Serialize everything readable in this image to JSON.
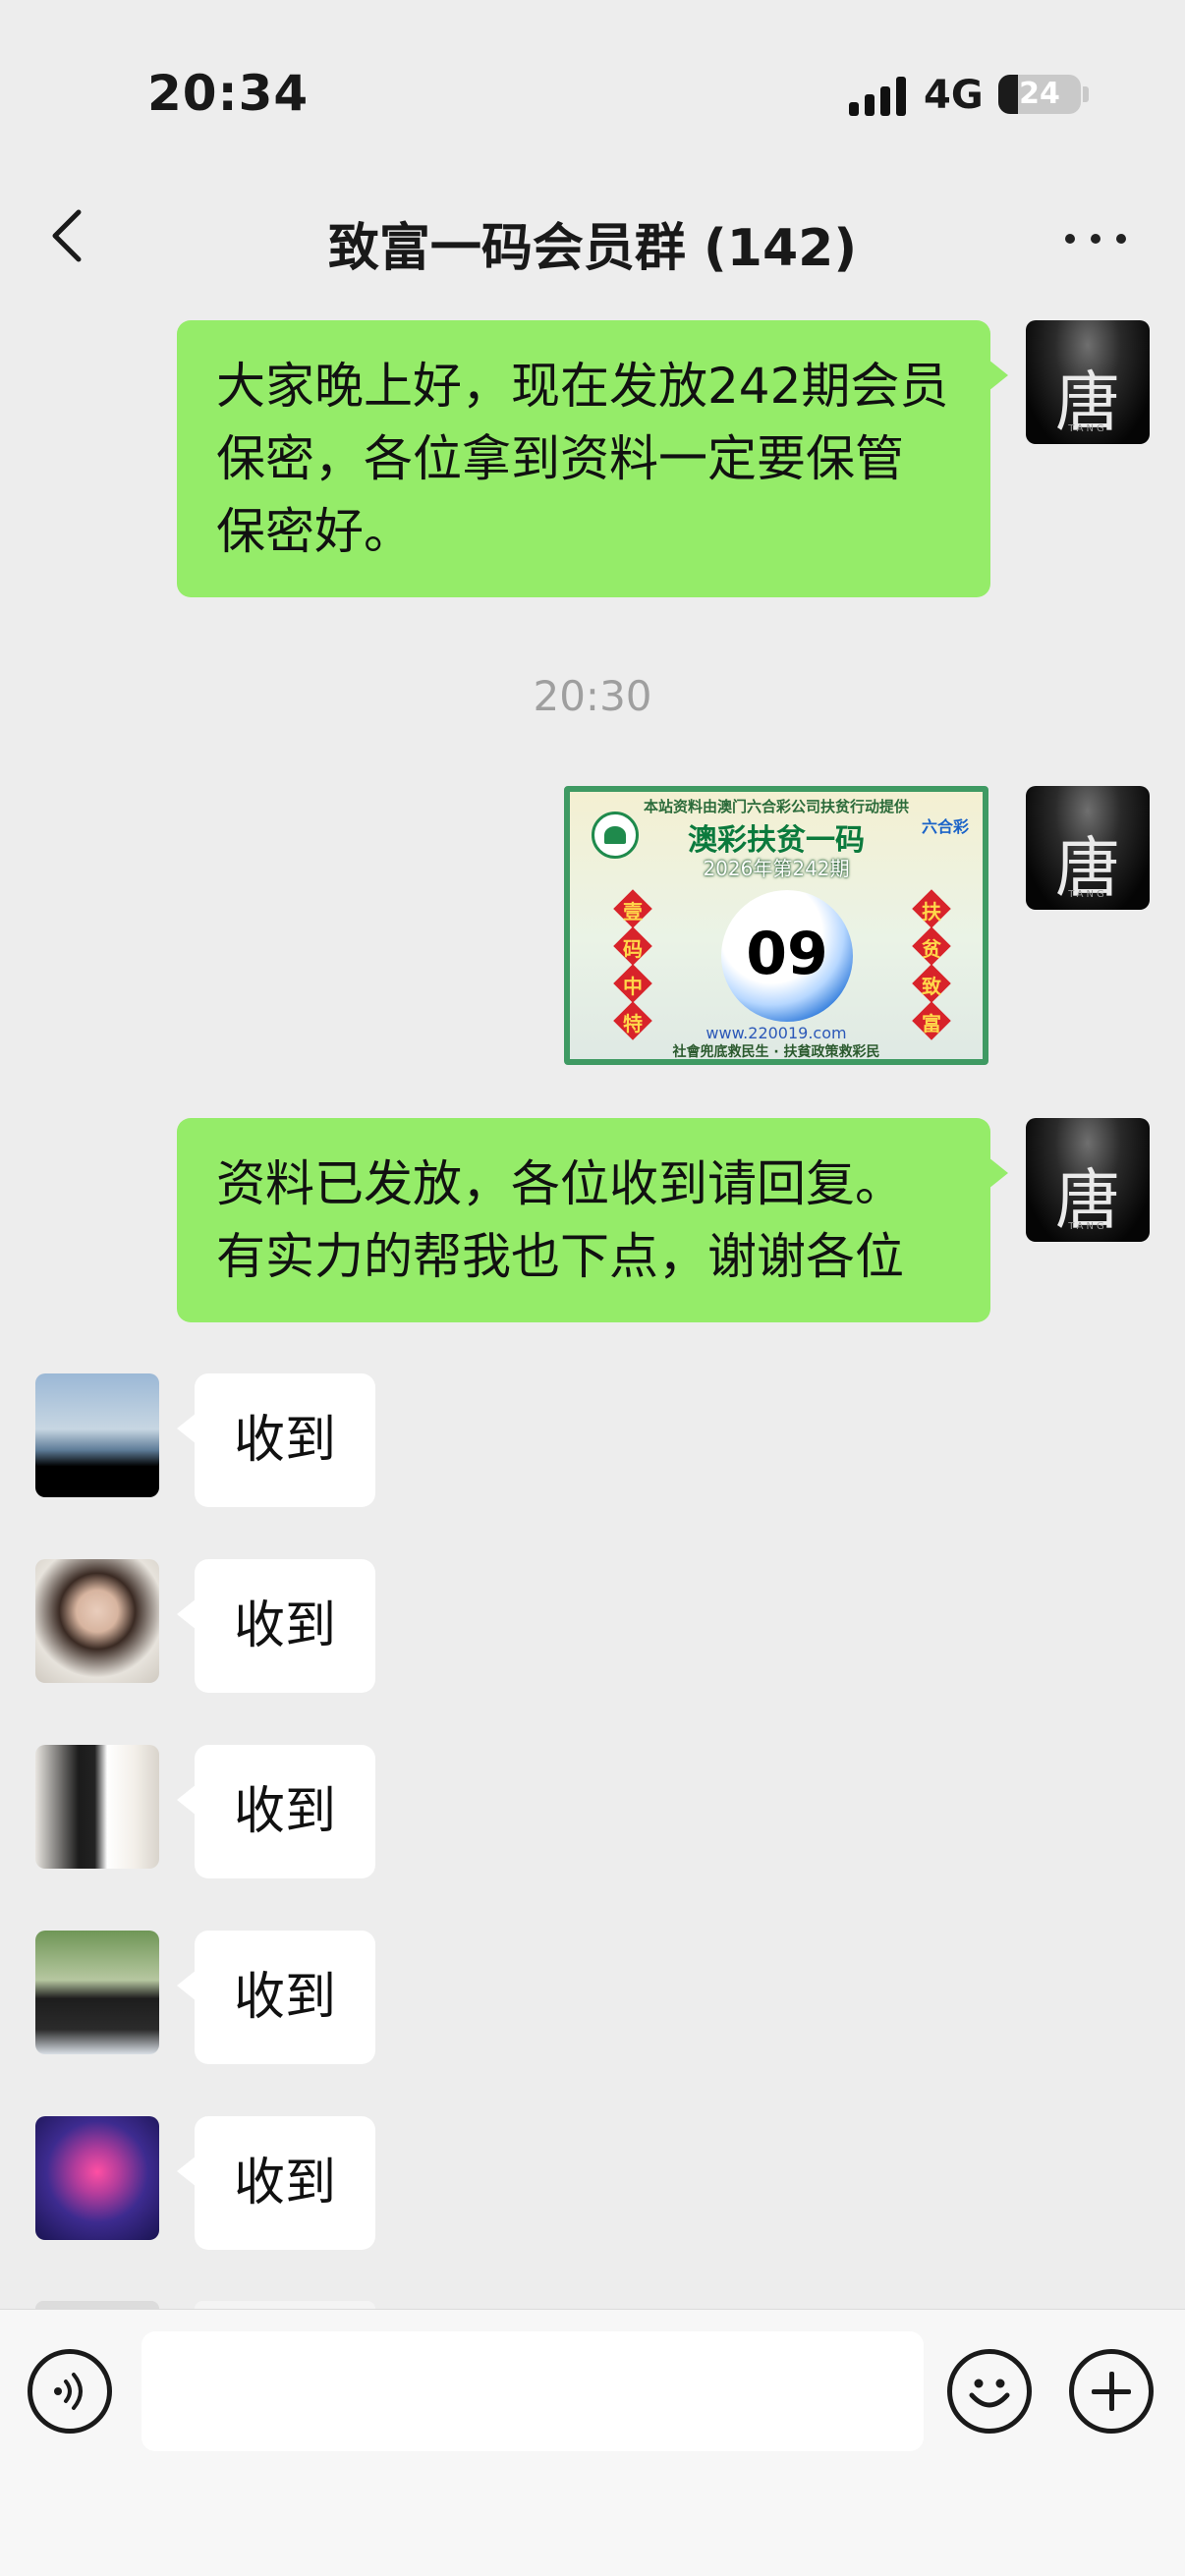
{
  "status_bar": {
    "time": "20:34",
    "network": "4G",
    "battery_level": "24"
  },
  "header": {
    "title": "致富一码会员群 (142)"
  },
  "avatar_text": {
    "glyph": "唐",
    "sub": "TANG"
  },
  "messages": [
    {
      "sender": "self",
      "text": "大家晚上好，现在发放242期会员保密，各位拿到资料一定要保管保密好。"
    },
    {
      "type": "timestamp",
      "text": "20:30"
    },
    {
      "sender": "self",
      "type": "image",
      "image": {
        "top_line": "本站资料由澳门六合彩公司扶贫行动提供",
        "title": "澳彩扶贫一码",
        "issue": "2026年第242期",
        "logo": "六合彩",
        "number": "09",
        "left_chars": [
          "壹",
          "码",
          "中",
          "特"
        ],
        "right_chars": [
          "扶",
          "贫",
          "致",
          "富"
        ],
        "url": "www.220019.com",
        "slogan": "社會兜底救民生 · 扶貧政策救彩民"
      }
    },
    {
      "sender": "self",
      "text": "资料已发放，各位收到请回复。有实力的帮我也下点，谢谢各位"
    },
    {
      "sender": "member1",
      "text": "收到"
    },
    {
      "sender": "member2",
      "text": "收到"
    },
    {
      "sender": "member3",
      "text": "收到"
    },
    {
      "sender": "member4",
      "text": "收到"
    },
    {
      "sender": "member5",
      "text": "收到"
    }
  ],
  "input_bar": {
    "value": "",
    "icons": [
      "voice-icon",
      "emoji-icon",
      "plus-icon"
    ]
  },
  "colors": {
    "background": "#ededed",
    "self_bubble": "#95ec69",
    "other_bubble": "#ffffff"
  }
}
